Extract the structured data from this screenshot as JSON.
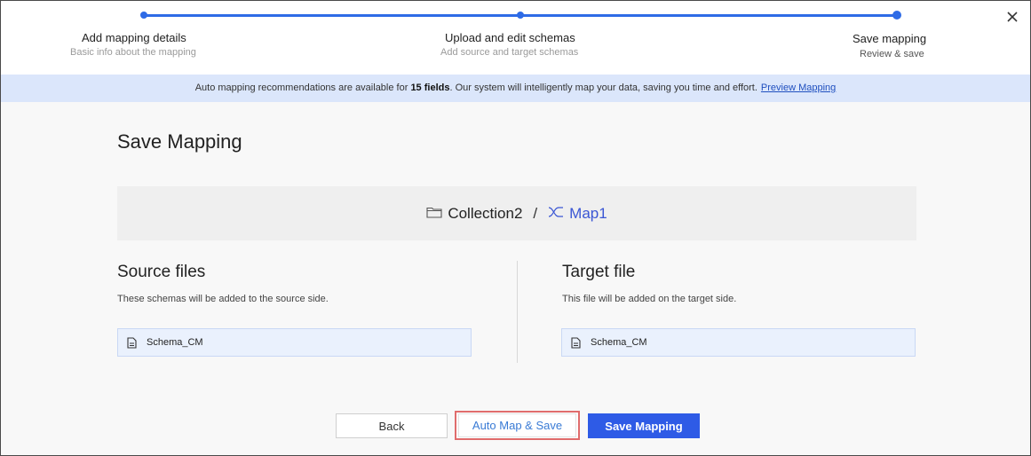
{
  "stepper": {
    "steps": [
      {
        "title": "Add mapping details",
        "subtitle": "Basic info about the mapping"
      },
      {
        "title": "Upload and edit schemas",
        "subtitle": "Add source and target schemas"
      },
      {
        "title": "Save mapping",
        "subtitle": "Review & save"
      }
    ],
    "accent_color": "#2e6be6"
  },
  "banner": {
    "text_before": "Auto mapping recommendations are available for ",
    "highlight": "15 fields",
    "text_after": ". Our system will intelligently map your data, saving you time and effort.",
    "link": "Preview Mapping"
  },
  "main": {
    "title": "Save Mapping",
    "path": {
      "collection": "Collection2",
      "separator": "/",
      "map": "Map1"
    },
    "source": {
      "title": "Source files",
      "description": "These schemas will be added to the source side.",
      "files": [
        "Schema_CM"
      ]
    },
    "target": {
      "title": "Target file",
      "description": "This file will be added on the target side.",
      "files": [
        "Schema_CM"
      ]
    }
  },
  "footer": {
    "back_label": "Back",
    "auto_label": "Auto Map & Save",
    "save_label": "Save Mapping"
  }
}
